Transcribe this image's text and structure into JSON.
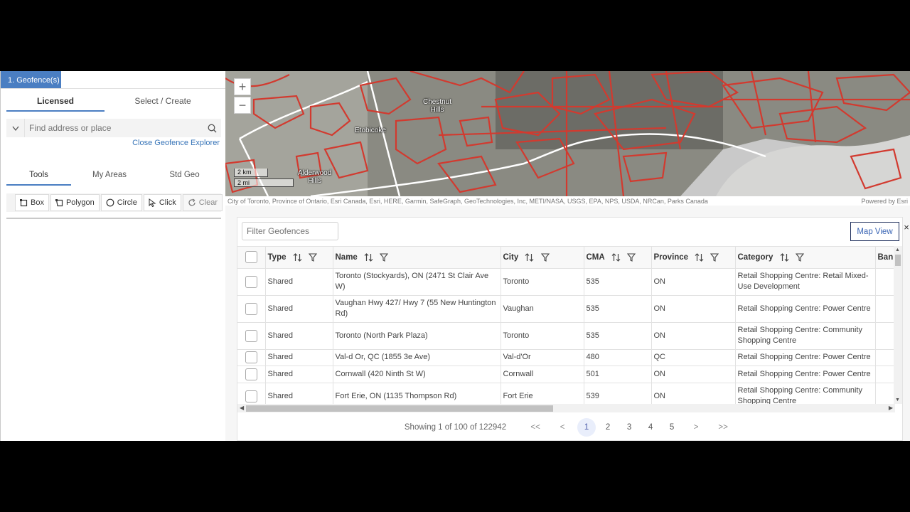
{
  "left_panel": {
    "step_tab": "1. Geofence(s)",
    "license_tabs": [
      "Licensed",
      "Select / Create"
    ],
    "search": {
      "placeholder": "Find address or place"
    },
    "close_explorer": "Close Geofence Explorer",
    "tool_tabs": [
      "Tools",
      "My Areas",
      "Std Geo"
    ],
    "tools": {
      "box": "Box",
      "polygon": "Polygon",
      "circle": "Circle",
      "click": "Click",
      "clear": "Clear"
    }
  },
  "map": {
    "zoom_in": "+",
    "zoom_out": "−",
    "scale_km": "2 km",
    "scale_mi": "2 mi",
    "labels": {
      "chestnut": "Chestnut\nHills",
      "etobicoke": "Etobicoke",
      "alderwood": "Alderwood\nHills"
    },
    "attribution": "City of Toronto, Province of Ontario, Esri Canada, Esri, HERE, Garmin, SafeGraph, GeoTechnologies, Inc, METI/NASA, USGS, EPA, NPS, USDA, NRCan, Parks Canada",
    "powered_by": "Powered by Esri"
  },
  "grid": {
    "filter_placeholder": "Filter Geofences",
    "map_view": "Map View",
    "close": "×",
    "columns": [
      "Type",
      "Name",
      "City",
      "CMA",
      "Province",
      "Category",
      "Ban"
    ],
    "rows": [
      {
        "type": "Shared",
        "name": "Toronto (Stockyards), ON (2471 St Clair Ave W)",
        "city": "Toronto",
        "cma": "535",
        "province": "ON",
        "category": "Retail Shopping Centre: Retail Mixed-Use Development"
      },
      {
        "type": "Shared",
        "name": "Vaughan Hwy 427/ Hwy 7 (55 New Huntington Rd)",
        "city": "Vaughan",
        "cma": "535",
        "province": "ON",
        "category": "Retail Shopping Centre: Power Centre"
      },
      {
        "type": "Shared",
        "name": "Toronto (North Park Plaza)",
        "city": "Toronto",
        "cma": "535",
        "province": "ON",
        "category": "Retail Shopping Centre: Community Shopping Centre"
      },
      {
        "type": "Shared",
        "name": "Val-d Or, QC (1855 3e Ave)",
        "city": "Val-d'Or",
        "cma": "480",
        "province": "QC",
        "category": "Retail Shopping Centre: Power Centre"
      },
      {
        "type": "Shared",
        "name": "Cornwall (420 Ninth St W)",
        "city": "Cornwall",
        "cma": "501",
        "province": "ON",
        "category": "Retail Shopping Centre: Power Centre"
      },
      {
        "type": "Shared",
        "name": "Fort Erie, ON (1135 Thompson Rd)",
        "city": "Fort Erie",
        "cma": "539",
        "province": "ON",
        "category": "Retail Shopping Centre: Community Shopping Centre"
      }
    ],
    "pager": {
      "status": "Showing 1 of 100 of 122942",
      "first": "<<",
      "prev": "<",
      "pages": [
        "1",
        "2",
        "3",
        "4",
        "5"
      ],
      "next": ">",
      "last": ">>",
      "current": "1"
    }
  },
  "colors": {
    "accent": "#4a7ec2",
    "geofence": "#d23a2f",
    "map_view_border": "#1c2d5a"
  }
}
